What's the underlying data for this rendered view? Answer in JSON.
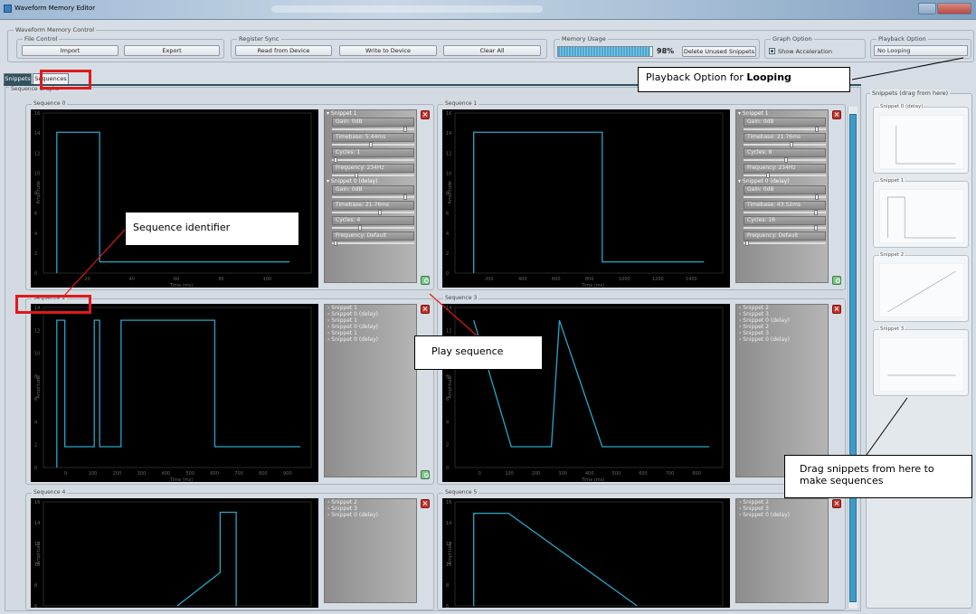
{
  "window": {
    "title": "Waveform Memory Editor"
  },
  "memory_control": {
    "label": "Waveform Memory Control",
    "file_control": {
      "label": "File Control",
      "import": "Import",
      "export": "Export"
    },
    "register_sync": {
      "label": "Register Sync",
      "read": "Read from Device",
      "write": "Write to Device",
      "clear": "Clear All"
    },
    "memory_usage": {
      "label": "Memory Usage",
      "percent_text": "98%",
      "percent_value": 0.98,
      "delete_btn": "Delete Unused Snippets"
    },
    "graph_option": {
      "label": "Graph Option",
      "show_accel": "Show Acceleration",
      "checked": true
    },
    "playback_option": {
      "label": "Playback Option",
      "value": "No Looping"
    }
  },
  "tabs": [
    {
      "label": "Snippets",
      "active": true
    },
    {
      "label": "Sequences",
      "active": false
    }
  ],
  "sequence_graphs_label": "Sequence Graphs",
  "sequences": [
    {
      "name": "Sequence 0",
      "x_label": "Time (ms)",
      "y_label": "Amplitude",
      "x_ticks": [
        "20",
        "40",
        "60",
        "80",
        "100"
      ],
      "y_ticks": [
        "16",
        "14",
        "12",
        "10",
        "8",
        "6",
        "4",
        "2",
        "0"
      ],
      "panel": [
        {
          "head": "Snippet 1",
          "params": [
            {
              "label": "Gain: 0dB",
              "v": 0.97
            },
            {
              "label": "Timebase: 5.44ms",
              "v": 0.5
            },
            {
              "label": "Cycles: 1",
              "v": 0.02
            },
            {
              "label": "Frequency: 234Hz",
              "v": 0.3
            }
          ]
        },
        {
          "head": "Snippet 0 (delay)",
          "params": [
            {
              "label": "Gain: 0dB",
              "v": 0.97
            },
            {
              "label": "Timebase: 21.76ms",
              "v": 0.62
            },
            {
              "label": "Cycles: 4",
              "v": 0.35
            },
            {
              "label": "Frequency: Default",
              "v": 0.02
            }
          ]
        }
      ]
    },
    {
      "name": "Sequence 1",
      "x_label": "Time (ms)",
      "y_label": "Amplitude",
      "x_ticks": [
        "200",
        "400",
        "600",
        "800",
        "1000",
        "1200",
        "1400"
      ],
      "y_ticks": [
        "16",
        "14",
        "12",
        "10",
        "8",
        "6",
        "4",
        "2",
        "0"
      ],
      "panel": [
        {
          "head": "Snippet 1",
          "params": [
            {
              "label": "Gain: 0dB",
              "v": 0.97
            },
            {
              "label": "Timebase: 21.76ms",
              "v": 0.62
            },
            {
              "label": "Cycles: 8",
              "v": 0.55
            },
            {
              "label": "Frequency: 234Hz",
              "v": 0.3
            }
          ]
        },
        {
          "head": "Snippet 0 (delay)",
          "params": [
            {
              "label": "Gain: 0dB",
              "v": 0.97
            },
            {
              "label": "Timebase: 43.52ms",
              "v": 0.95
            },
            {
              "label": "Cycles: 16",
              "v": 0.95
            },
            {
              "label": "Frequency: Default",
              "v": 0.02
            }
          ]
        }
      ]
    },
    {
      "name": "Sequence 2",
      "x_label": "Time (ms)",
      "y_label": "Amplitude",
      "x_ticks": [
        "0",
        "100",
        "200",
        "300",
        "400",
        "500",
        "600",
        "700",
        "800",
        "900"
      ],
      "y_ticks": [
        "14",
        "12",
        "10",
        "8",
        "6",
        "4",
        "2",
        "0"
      ],
      "list": [
        "Snippet 1",
        "Snippet 0 (delay)",
        "Snippet 1",
        "Snippet 0 (delay)",
        "Snippet 1",
        "Snippet 0 (delay)"
      ]
    },
    {
      "name": "Sequence 3",
      "x_label": "Time (ms)",
      "y_label": "Amplitude",
      "x_ticks": [
        "0",
        "100",
        "200",
        "300",
        "400",
        "500",
        "600",
        "700",
        "800"
      ],
      "y_ticks": [
        "14",
        "12",
        "10",
        "8",
        "6",
        "4",
        "2",
        "0"
      ],
      "list": [
        "Snippet 2",
        "Snippet 3",
        "Snippet 0 (delay)",
        "Snippet 2",
        "Snippet 3",
        "Snippet 0 (delay)"
      ]
    },
    {
      "name": "Sequence 4",
      "y_label": "Amplitude",
      "y_ticks": [
        "16",
        "14",
        "12",
        "10",
        "8",
        "6"
      ],
      "list": [
        "Snippet 2",
        "Snippet 3",
        "Snippet 0 (delay)"
      ]
    },
    {
      "name": "Sequence 5",
      "y_label": "Amplitude",
      "y_ticks": [
        "16",
        "14",
        "12",
        "10",
        "8",
        "6"
      ],
      "list": [
        "Snippet 2",
        "Snippet 3",
        "Snippet 0 (delay)"
      ]
    }
  ],
  "snippets_panel": {
    "label": "Snippets (drag from here)",
    "items": [
      "Snippet 0 (delay)",
      "Snippet 1",
      "Snippet 2",
      "Snippet 3"
    ]
  },
  "callouts": {
    "playback": "Playback Option for ",
    "playback_bold": "Looping",
    "seq_id": "Sequence identifier",
    "play": "Play sequence",
    "drag": "Drag snippets from here to make sequences"
  },
  "colors": {
    "waveform": "#29a6c8",
    "highlight": "#e0191b"
  }
}
